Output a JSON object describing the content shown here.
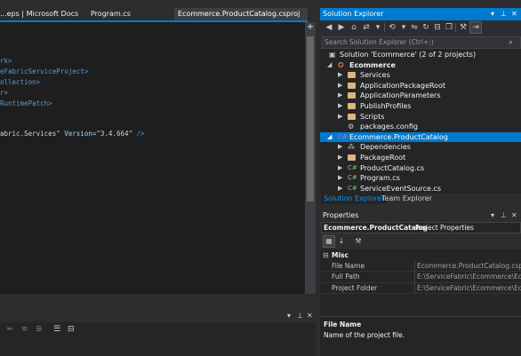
{
  "editor": {
    "tabs": [
      {
        "label": "...eps | Microsoft Docs",
        "active": false
      },
      {
        "label": "Program.cs",
        "active": false
      },
      {
        "label": "Ecommerce.ProductCatalog.csproj",
        "active": true
      }
    ],
    "code_lines": [
      {
        "text": "rk>"
      },
      {
        "text": "eFabricServiceProject>"
      },
      {
        "text": "ollection>"
      },
      {
        "text": "r>"
      },
      {
        "text": "RuntimePatch>"
      },
      {
        "pre": "abric.Services\"",
        "attr": " Version=",
        "str": "\"3.4.664\"",
        "post": " />"
      }
    ]
  },
  "solution_explorer": {
    "title": "Solution Explorer",
    "search_placeholder": "Search Solution Explorer (Ctrl+;)",
    "tree": [
      {
        "label": "Solution 'Ecommerce' (2 of 2 projects)",
        "arrow": "",
        "icon": "solution-icon",
        "bold": false,
        "selected": false
      },
      {
        "label": "Ecommerce",
        "arrow": "◢",
        "icon": "fabric-app-icon",
        "bold": true,
        "selected": false
      },
      {
        "label": "Services",
        "arrow": "▶",
        "icon": "services-icon",
        "bold": false,
        "selected": false
      },
      {
        "label": "ApplicationPackageRoot",
        "arrow": "▶",
        "icon": "folder-icon",
        "bold": false,
        "selected": false
      },
      {
        "label": "ApplicationParameters",
        "arrow": "▶",
        "icon": "folder-icon",
        "bold": false,
        "selected": false
      },
      {
        "label": "PublishProfiles",
        "arrow": "▶",
        "icon": "folder-icon",
        "bold": false,
        "selected": false
      },
      {
        "label": "Scripts",
        "arrow": "▶",
        "icon": "folder-icon",
        "bold": false,
        "selected": false
      },
      {
        "label": "packages.config",
        "arrow": "",
        "icon": "config-file-icon",
        "bold": false,
        "selected": false
      },
      {
        "label": "Ecommerce.ProductCatalog",
        "arrow": "◢",
        "icon": "csharp-project-icon",
        "bold": true,
        "selected": true
      },
      {
        "label": "Dependencies",
        "arrow": "▶",
        "icon": "dependencies-icon",
        "bold": false,
        "selected": false
      },
      {
        "label": "PackageRoot",
        "arrow": "▶",
        "icon": "folder-icon",
        "bold": false,
        "selected": false
      },
      {
        "label": "ProductCatalog.cs",
        "arrow": "▶",
        "icon": "csharp-file-icon",
        "bold": false,
        "selected": false
      },
      {
        "label": "Program.cs",
        "arrow": "▶",
        "icon": "csharp-file-icon",
        "bold": false,
        "selected": false
      },
      {
        "label": "ServiceEventSource.cs",
        "arrow": "▶",
        "icon": "csharp-file-icon",
        "bold": false,
        "selected": false
      }
    ],
    "bottom_tabs": [
      {
        "label": "Solution Explorer",
        "active": true
      },
      {
        "label": "Team Explorer",
        "active": false
      }
    ]
  },
  "properties": {
    "title": "Properties",
    "object_name": "Ecommerce.ProductCatalog",
    "object_type": "Project Properties",
    "category": "Misc",
    "rows": [
      {
        "name": "File Name",
        "value": "Ecommerce.ProductCatalog.cspr"
      },
      {
        "name": "Full Path",
        "value": "E:\\ServiceFabric\\Ecommerce\\Eco"
      },
      {
        "name": "Project Folder",
        "value": "E:\\ServiceFabric\\Ecommerce\\Eco"
      }
    ],
    "description_title": "File Name",
    "description_text": "Name of the project file."
  },
  "colors": {
    "accent": "#007acc",
    "editor_bg": "#1e1e1e",
    "chrome_bg": "#2d2d30",
    "panel_bg": "#252526",
    "xml_tag": "#569cd6",
    "xml_attr": "#9cdcfe",
    "folder": "#dcb67a",
    "csharp": "#68217a"
  }
}
